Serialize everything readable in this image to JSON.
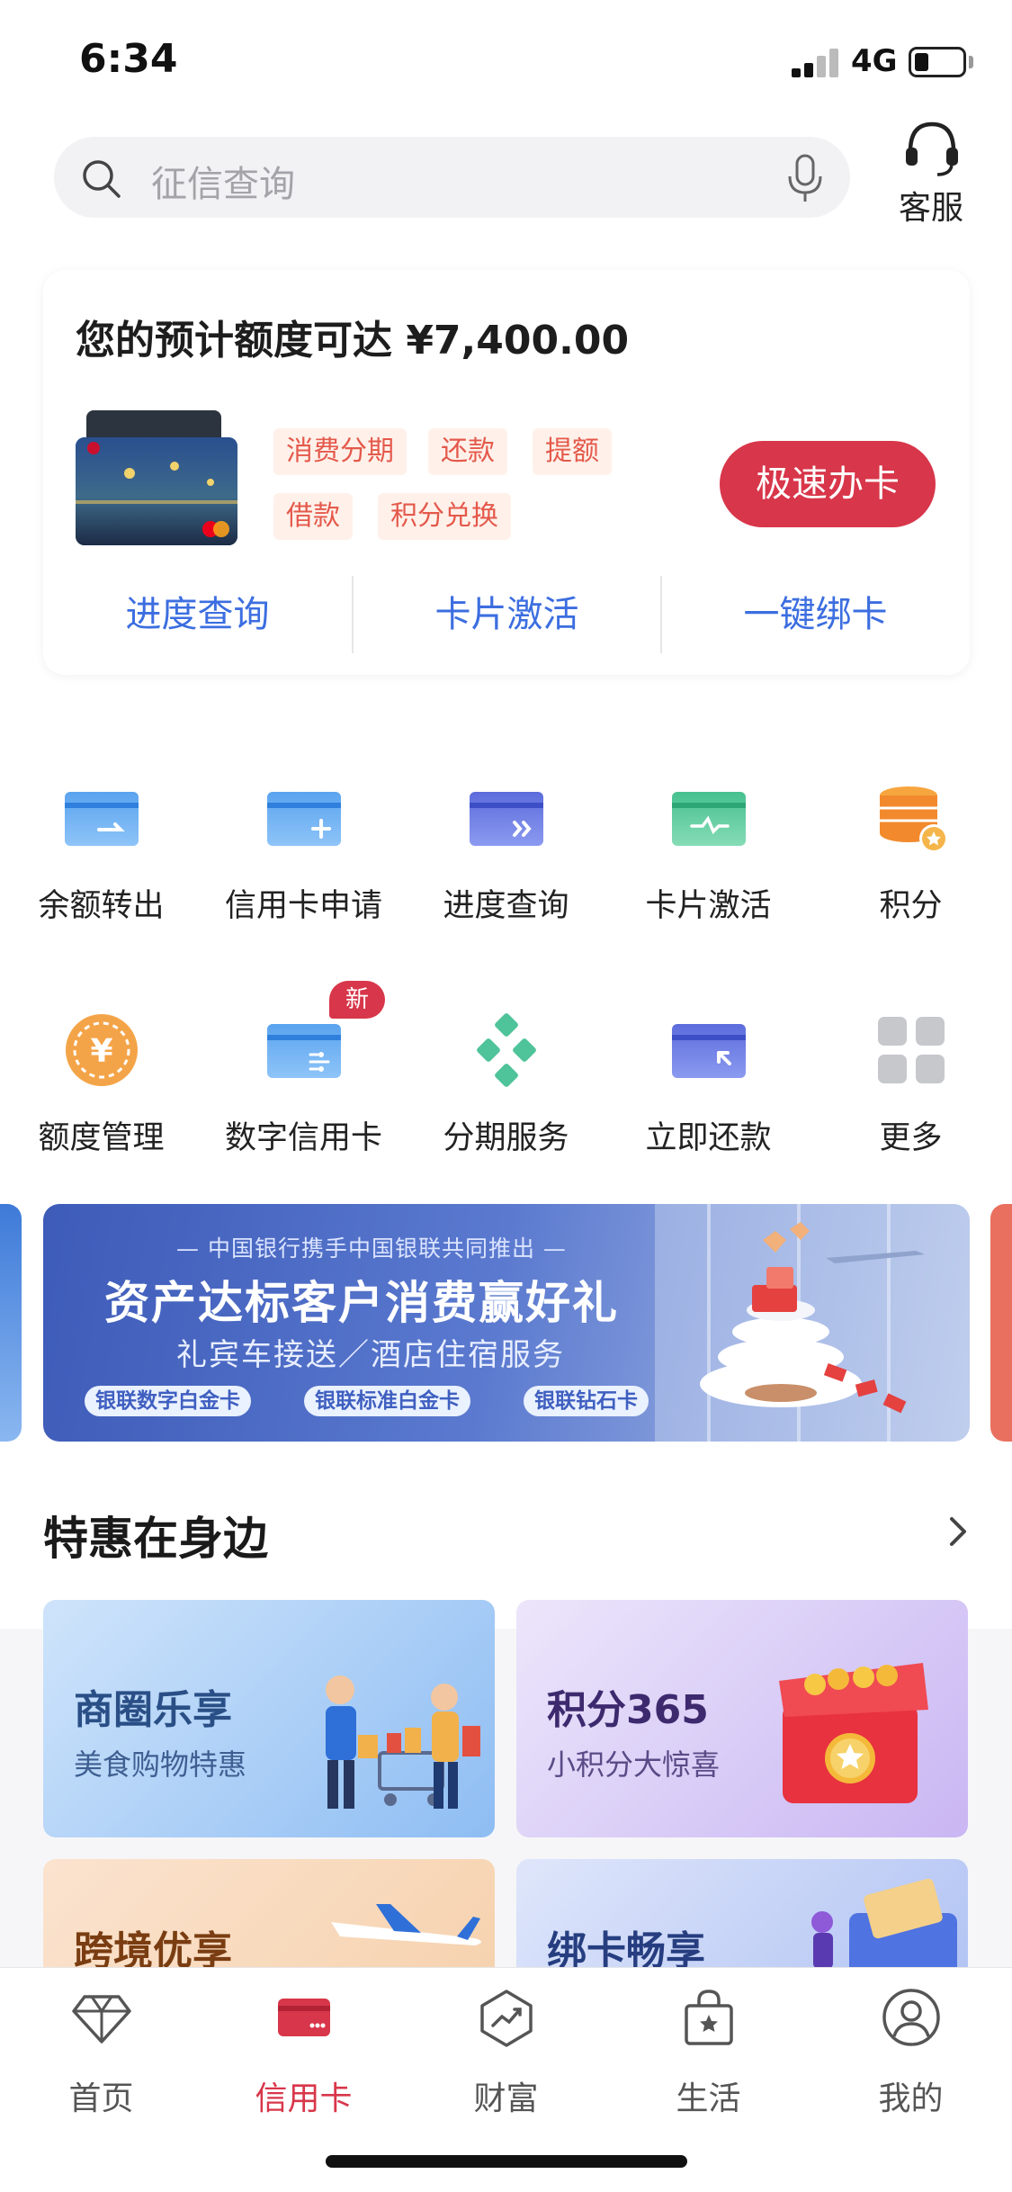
{
  "status": {
    "time": "6:34",
    "network": "4G"
  },
  "search": {
    "placeholder": "征信查询",
    "service_label": "客服"
  },
  "promo": {
    "title": "您的预计额度可达 ¥7,400.00",
    "tags": [
      "消费分期",
      "还款",
      "提额",
      "借款",
      "积分兑换"
    ],
    "apply_button": "极速办卡",
    "links": [
      "进度查询",
      "卡片激活",
      "一键绑卡"
    ]
  },
  "grid": {
    "row1": [
      {
        "label": "余额转出",
        "icon": "balance-transfer-icon"
      },
      {
        "label": "信用卡申请",
        "icon": "card-apply-icon"
      },
      {
        "label": "进度查询",
        "icon": "progress-query-icon"
      },
      {
        "label": "卡片激活",
        "icon": "card-activate-icon"
      },
      {
        "label": "积分",
        "icon": "points-icon"
      }
    ],
    "row2": [
      {
        "label": "额度管理",
        "icon": "limit-management-icon"
      },
      {
        "label": "数字信用卡",
        "icon": "digital-card-icon"
      },
      {
        "label": "分期服务",
        "icon": "installment-icon"
      },
      {
        "label": "立即还款",
        "icon": "repay-icon"
      },
      {
        "label": "更多",
        "icon": "more-icon"
      }
    ],
    "new_badge": "新"
  },
  "banner": {
    "subtitle": "— 中国银行携手中国银联共同推出 —",
    "title": "资产达标客户消费赢好礼",
    "line2": "礼宾车接送／酒店住宿服务",
    "pills": [
      "银联数字白金卡",
      "银联标准白金卡",
      "银联钻石卡"
    ]
  },
  "benefits": {
    "section_title": "特惠在身边",
    "tiles": [
      {
        "title": "商圈乐享",
        "subtitle": "美食购物特惠"
      },
      {
        "title": "积分365",
        "subtitle": "小积分大惊喜"
      },
      {
        "title": "跨境优享",
        "subtitle": ""
      },
      {
        "title": "绑卡畅享",
        "subtitle": ""
      }
    ]
  },
  "tabbar": {
    "tabs": [
      {
        "label": "首页",
        "icon": "diamond-icon"
      },
      {
        "label": "信用卡",
        "icon": "credit-card-icon"
      },
      {
        "label": "财富",
        "icon": "wealth-icon"
      },
      {
        "label": "生活",
        "icon": "shopping-bag-icon"
      },
      {
        "label": "我的",
        "icon": "user-icon"
      }
    ],
    "active_index": 1
  },
  "colors": {
    "accent": "#d8364a",
    "link_blue": "#3c6ee0",
    "tag_text": "#e4594b"
  }
}
